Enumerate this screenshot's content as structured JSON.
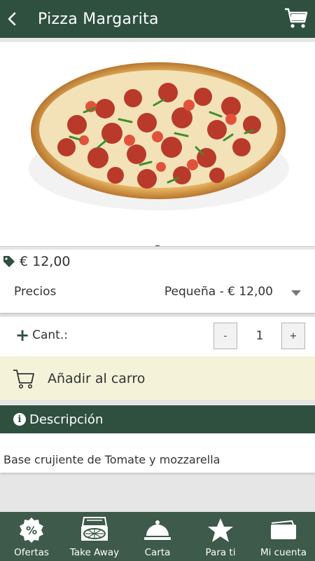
{
  "header": {
    "title": "Pizza Margarita"
  },
  "product": {
    "price": "€ 12,00",
    "precios_label": "Precios",
    "precios_selected": "Pequeña - € 12,00",
    "qty_label": "Cant.:",
    "qty_minus": "-",
    "qty_value": "1",
    "qty_plus": "+",
    "add_to_cart": "Añadir al carro"
  },
  "description": {
    "heading": "Descripción",
    "text": "Base crujiente de Tomate y mozzarella"
  },
  "tabs": [
    {
      "label": "Ofertas",
      "icon": "percent-badge-icon"
    },
    {
      "label": "Take Away",
      "icon": "pizza-box-icon"
    },
    {
      "label": "Carta",
      "icon": "cloche-icon"
    },
    {
      "label": "Para ti",
      "icon": "star-icon"
    },
    {
      "label": "Mi cuenta",
      "icon": "wallet-icon"
    }
  ],
  "colors": {
    "primary": "#2f4f3f",
    "tabbar": "#3d5a4a",
    "cart_bg": "#f4f3da"
  }
}
